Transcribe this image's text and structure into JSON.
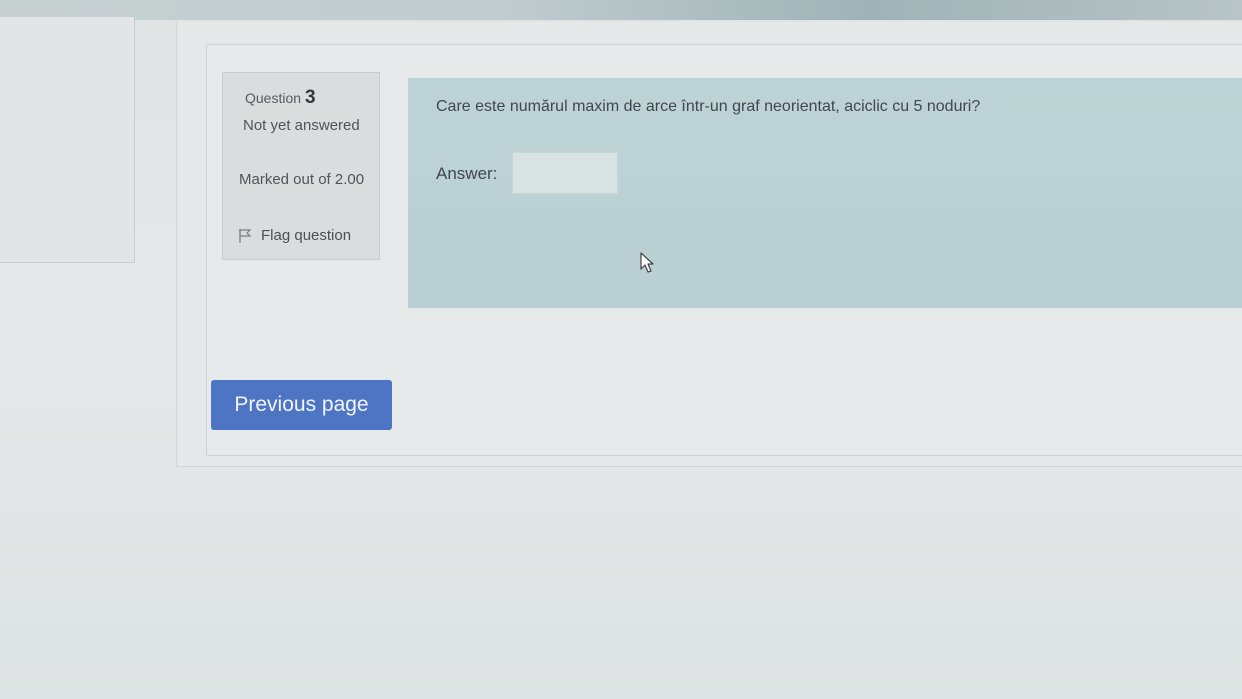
{
  "question": {
    "label": "Question",
    "number": "3",
    "state": "Not yet answered",
    "grade": "Marked out of 2.00",
    "flag_label": "Flag question",
    "text": "Care este numărul maxim de arce într-un graf neorientat, aciclic cu 5 noduri?",
    "answer_label": "Answer:",
    "answer_value": "",
    "flag_icon": "flag-icon",
    "cursor_icon": "mouse-pointer-icon"
  },
  "navigation": {
    "previous_label": "Previous page"
  },
  "colors": {
    "button": "#4e74c4",
    "question_panel": "#bed3d5",
    "info_panel": "#d9ddde"
  }
}
